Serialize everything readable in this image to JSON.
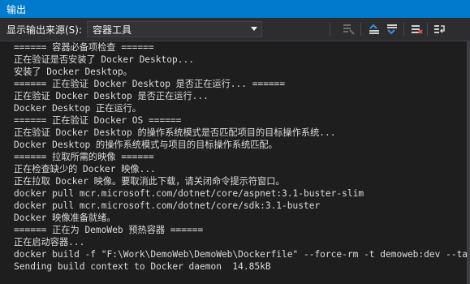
{
  "window": {
    "title": "输出"
  },
  "toolbar": {
    "source_label": "显示输出来源(S):",
    "source_value": "容器工具"
  },
  "output_lines": [
    "====== 容器必备项检查 ======",
    "正在验证是否安装了 Docker Desktop...",
    "安装了 Docker Desktop。",
    "====== 正在验证 Docker Desktop 是否正在运行... ======",
    "正在验证 Docker Desktop 是否正在运行...",
    "Docker Desktop 正在运行。",
    "====== 正在验证 Docker OS ======",
    "正在验证 Docker Desktop 的操作系统模式是否匹配项目的目标操作系统...",
    "Docker Desktop 的操作系统模式与项目的目标操作系统匹配。",
    "====== 拉取所需的映像 ======",
    "正在检查缺少的 Docker 映像...",
    "正在拉取 Docker 映像。要取消此下载，请关闭命令提示符窗口。",
    "docker pull mcr.microsoft.com/dotnet/core/aspnet:3.1-buster-slim",
    "docker pull mcr.microsoft.com/dotnet/core/sdk:3.1-buster",
    "Docker 映像准备就绪。",
    "====== 正在为 DemoWeb 预热容器 ======",
    "正在启动容器...",
    "docker build -f \"F:\\Work\\DemoWeb\\DemoWeb\\Dockerfile\" --force-rm -t demoweb:dev --target base",
    "Sending build context to Docker daemon  14.85kB"
  ],
  "colors": {
    "accent": "#007acc",
    "background": "#1e1e1e",
    "toolbar": "#2d2d30",
    "text": "#dcdcdc"
  },
  "icons": [
    "dropdown-arrow-icon",
    "find-message-icon",
    "previous-message-icon",
    "next-message-icon",
    "clear-all-icon",
    "toggle-word-wrap-icon"
  ]
}
